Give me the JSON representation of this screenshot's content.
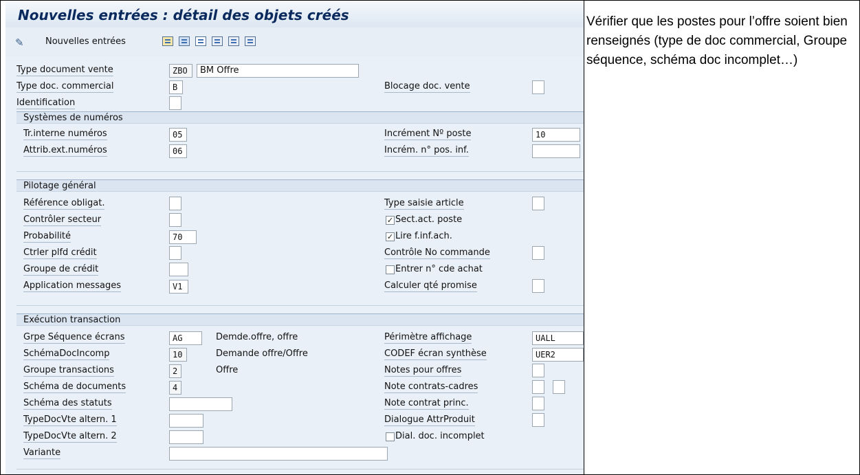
{
  "title": "Nouvelles entrées : détail des objets créés",
  "toolbar": {
    "new_entries_label": "Nouvelles entrées",
    "icons": [
      "pencil-icon",
      "copy-icon",
      "delete-icon",
      "undo-icon",
      "prev-icon",
      "next-icon",
      "select-icon"
    ]
  },
  "header": {
    "type_doc_vente_label": "Type document vente",
    "type_doc_vente_code": "ZBO",
    "type_doc_vente_text": "BM Offre",
    "type_doc_commercial_label": "Type doc. commercial",
    "type_doc_commercial_value": "B",
    "blocage_label": "Blocage doc. vente",
    "identification_label": "Identification"
  },
  "numeros": {
    "heading": "Systèmes de numéros",
    "tr_interne_label": "Tr.interne numéros",
    "tr_interne_value": "05",
    "attrib_ext_label": "Attrib.ext.numéros",
    "attrib_ext_value": "06",
    "increment_poste_label": "Incrément Nº poste",
    "increment_poste_value": "10",
    "increm_pos_inf_label": "Incrém. n° pos. inf.",
    "increm_pos_inf_value": ""
  },
  "pilotage": {
    "heading": "Pilotage général",
    "reference_label": "Référence obligat.",
    "controler_secteur_label": "Contrôler secteur",
    "probabilite_label": "Probabilité",
    "probabilite_value": "70",
    "ctrler_plfd_label": "Ctrler plfd crédit",
    "groupe_credit_label": "Groupe de crédit",
    "application_messages_label": "Application messages",
    "application_messages_value": "V1",
    "type_saisie_label": "Type saisie article",
    "sect_act_label": "Sect.act. poste",
    "lire_finf_label": "Lire f.inf.ach.",
    "controle_no_cmd_label": "Contrôle No commande",
    "entrer_cde_label": "Entrer n° cde achat",
    "calculer_qte_label": "Calculer qté promise",
    "checkmark": "✓"
  },
  "execution": {
    "heading": "Exécution transaction",
    "grpe_seq_label": "Grpe Séquence écrans",
    "grpe_seq_value": "AG",
    "grpe_seq_desc": "Demde.offre, offre",
    "schema_incomp_label": "SchémaDocIncomp",
    "schema_incomp_value": "10",
    "schema_incomp_desc": "Demande offre/Offre",
    "groupe_trans_label": "Groupe transactions",
    "groupe_trans_value": "2",
    "groupe_trans_desc": "Offre",
    "schema_docs_label": "Schéma de documents",
    "schema_docs_value": "4",
    "schema_statuts_label": "Schéma des statuts",
    "altern1_label": "TypeDocVte altern. 1",
    "altern2_label": "TypeDocVte altern. 2",
    "variante_label": "Variante",
    "perimetre_label": "Périmètre affichage",
    "perimetre_value": "UALL",
    "codef_label": "CODEF écran synthèse",
    "codef_value": "UER2",
    "notes_offres_label": "Notes pour offres",
    "note_contrats_label": "Note contrats-cadres",
    "note_contrat_princ_label": "Note contrat princ.",
    "dialogue_attr_label": "Dialogue AttrProduit",
    "dial_incomplet_label": "Dial. doc. incomplet"
  },
  "note": "Vérifier que les postes pour l’offre soient bien renseignés (type de doc commercial, Groupe séquence, schéma doc incomplet…)"
}
